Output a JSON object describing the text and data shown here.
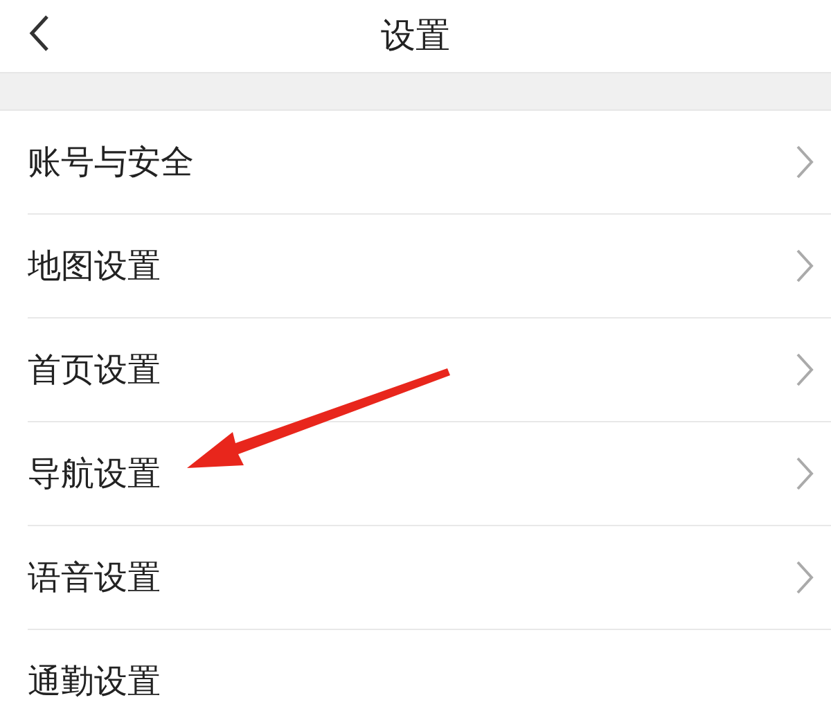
{
  "header": {
    "title": "设置"
  },
  "items": [
    {
      "label": "账号与安全",
      "arrow": true
    },
    {
      "label": "地图设置",
      "arrow": true
    },
    {
      "label": "首页设置",
      "arrow": true
    },
    {
      "label": "导航设置",
      "arrow": true
    },
    {
      "label": "语音设置",
      "arrow": true
    },
    {
      "label": "通勤设置",
      "arrow": false
    }
  ]
}
